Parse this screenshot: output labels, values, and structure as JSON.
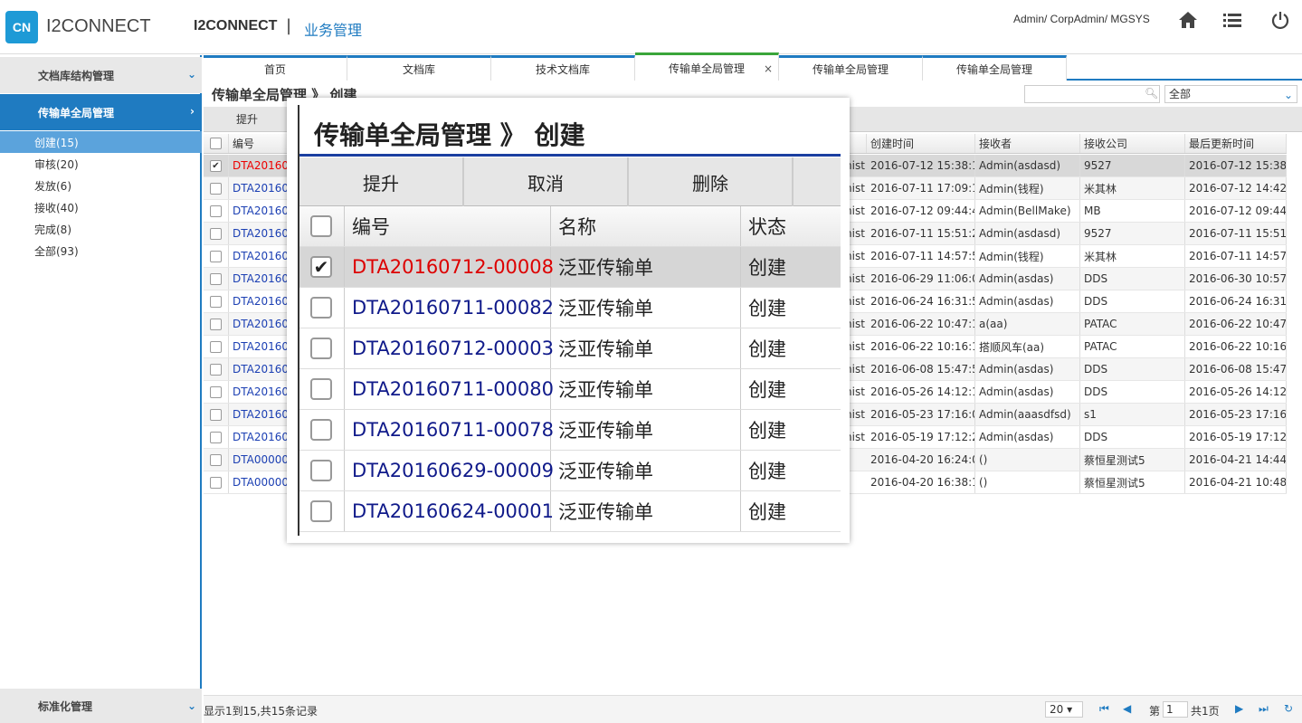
{
  "header": {
    "logo_mark": "CN",
    "logo_text": "I2CONNECT",
    "brand": "I2CONNECT",
    "separator": "|",
    "module": "业务管理",
    "user_path": "Admin/ CorpAdmin/ MGSYS",
    "icons": [
      "home-icon",
      "list-icon",
      "power-icon"
    ]
  },
  "sidebar": {
    "group1": "文档库结构管理",
    "group2": "传输单全局管理",
    "items": [
      {
        "label": "创建(15)"
      },
      {
        "label": "审核(20)"
      },
      {
        "label": "发放(6)"
      },
      {
        "label": "接收(40)"
      },
      {
        "label": "完成(8)"
      },
      {
        "label": "全部(93)"
      }
    ],
    "bottom": "标准化管理"
  },
  "tabs": [
    "首页",
    "文档库",
    "技术文档库",
    "传输单全局管理",
    "传输单全局管理",
    "传输单全局管理"
  ],
  "tab_close": "×",
  "page_heading": "传输单全局管理 》 创建",
  "filter_value": "全部",
  "toolbar": {
    "promote": "提升"
  },
  "grid": {
    "headers": {
      "id": "编号",
      "created": "创建时间",
      "receiver": "接收者",
      "company": "接收公司",
      "updated": "最后更新时间"
    },
    "rows": [
      {
        "id": "DTA20160",
        "partial": "nist",
        "created": "2016-07-12 15:38:1",
        "receiver": "Admin(asdasd)",
        "company": "9527",
        "updated": "2016-07-12 15:38:1"
      },
      {
        "id": "DTA20160",
        "partial": "nist",
        "created": "2016-07-11 17:09:1",
        "receiver": "Admin(钱程)",
        "company": "米其林",
        "updated": "2016-07-12 14:42:4"
      },
      {
        "id": "DTA20160",
        "partial": "nist",
        "created": "2016-07-12 09:44:4",
        "receiver": "Admin(BellMake)",
        "company": "MB",
        "updated": "2016-07-12 09:44:4"
      },
      {
        "id": "DTA20160",
        "partial": "nist",
        "created": "2016-07-11 15:51:2",
        "receiver": "Admin(asdasd)",
        "company": "9527",
        "updated": "2016-07-11 15:51:2"
      },
      {
        "id": "DTA20160",
        "partial": "nist",
        "created": "2016-07-11 14:57:5",
        "receiver": "Admin(钱程)",
        "company": "米其林",
        "updated": "2016-07-11 14:57:5"
      },
      {
        "id": "DTA20160",
        "partial": "nist",
        "created": "2016-06-29 11:06:0",
        "receiver": "Admin(asdas)",
        "company": "DDS",
        "updated": "2016-06-30 10:57:1"
      },
      {
        "id": "DTA20160",
        "partial": "nist",
        "created": "2016-06-24 16:31:5",
        "receiver": "Admin(asdas)",
        "company": "DDS",
        "updated": "2016-06-24 16:31:5"
      },
      {
        "id": "DTA20160",
        "partial": "nist",
        "created": "2016-06-22 10:47:1",
        "receiver": "a(aa)",
        "company": "PATAC",
        "updated": "2016-06-22 10:47:1"
      },
      {
        "id": "DTA20160",
        "partial": "nist",
        "created": "2016-06-22 10:16:1",
        "receiver": "搭顺风车(aa)",
        "company": "PATAC",
        "updated": "2016-06-22 10:16:1"
      },
      {
        "id": "DTA20160",
        "partial": "nist",
        "created": "2016-06-08 15:47:5",
        "receiver": "Admin(asdas)",
        "company": "DDS",
        "updated": "2016-06-08 15:47:5"
      },
      {
        "id": "DTA20160",
        "partial": "nist",
        "created": "2016-05-26 14:12:1",
        "receiver": "Admin(asdas)",
        "company": "DDS",
        "updated": "2016-05-26 14:12:1"
      },
      {
        "id": "DTA20160",
        "partial": "nist",
        "created": "2016-05-23 17:16:0",
        "receiver": "Admin(aaasdfsd)",
        "company": "s1",
        "updated": "2016-05-23 17:16:0"
      },
      {
        "id": "DTA20160",
        "partial": "nist",
        "created": "2016-05-19 17:12:2",
        "receiver": "Admin(asdas)",
        "company": "DDS",
        "updated": "2016-05-19 17:12:2"
      },
      {
        "id": "DTA00000",
        "partial": "",
        "created": "2016-04-20 16:24:0",
        "receiver": "()",
        "company": "蔡恒星测试5",
        "updated": "2016-04-21 14:44:0"
      },
      {
        "id": "DTA00000",
        "partial": "",
        "created": "2016-04-20 16:38:1",
        "receiver": "()",
        "company": "蔡恒星测试5",
        "updated": "2016-04-21 10:48:0"
      }
    ]
  },
  "footer": {
    "info": "显示1到15,共15条记录",
    "page_size": "20",
    "page_label_a": "第",
    "page_value": "1",
    "page_label_b": "共1页"
  },
  "zoom": {
    "title": "传输单全局管理 》 创建",
    "toolbar": [
      "提升",
      "取消",
      "删除"
    ],
    "headers": {
      "id": "编号",
      "name": "名称",
      "status": "状态"
    },
    "rows": [
      {
        "id": "DTA20160712-00008",
        "name": "泛亚传输单",
        "status": "创建",
        "checked": "✔"
      },
      {
        "id": "DTA20160711-00082",
        "name": "泛亚传输单",
        "status": "创建",
        "checked": ""
      },
      {
        "id": "DTA20160712-00003",
        "name": "泛亚传输单",
        "status": "创建",
        "checked": ""
      },
      {
        "id": "DTA20160711-00080",
        "name": "泛亚传输单",
        "status": "创建",
        "checked": ""
      },
      {
        "id": "DTA20160711-00078",
        "name": "泛亚传输单",
        "status": "创建",
        "checked": ""
      },
      {
        "id": "DTA20160629-00009",
        "name": "泛亚传输单",
        "status": "创建",
        "checked": ""
      },
      {
        "id": "DTA20160624-00001",
        "name": "泛亚传输单",
        "status": "创建",
        "checked": ""
      }
    ]
  },
  "colors": {
    "accent": "#1f7bc1",
    "link": "#1b3fb3",
    "selected_link": "#e00000"
  }
}
